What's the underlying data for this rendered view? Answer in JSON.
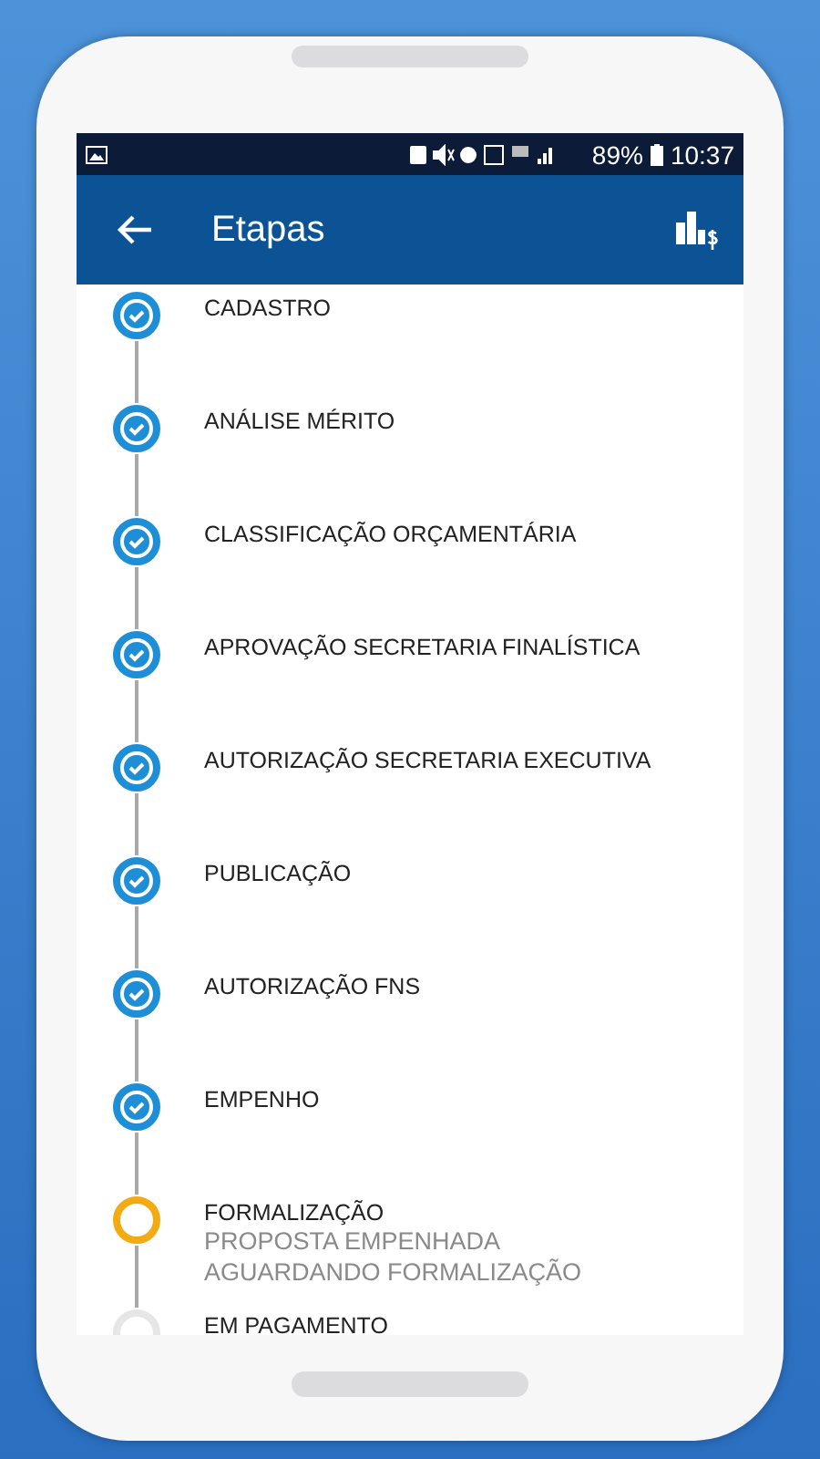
{
  "status_bar": {
    "battery": "89%",
    "time": "10:37"
  },
  "app_bar": {
    "title": "Etapas"
  },
  "steps": [
    {
      "label": "CADASTRO",
      "completed": true,
      "current": false
    },
    {
      "label": "ANÁLISE MÉRITO",
      "completed": true,
      "current": false
    },
    {
      "label": "CLASSIFICAÇÃO ORÇAMENTÁRIA",
      "completed": true,
      "current": false
    },
    {
      "label": "APROVAÇÃO SECRETARIA FINALÍSTICA",
      "completed": true,
      "current": false
    },
    {
      "label": "AUTORIZAÇÃO SECRETARIA EXECUTIVA",
      "completed": true,
      "current": false
    },
    {
      "label": "PUBLICAÇÃO",
      "completed": true,
      "current": false
    },
    {
      "label": "AUTORIZAÇÃO FNS",
      "completed": true,
      "current": false
    },
    {
      "label": "EMPENHO",
      "completed": true,
      "current": false
    },
    {
      "label": "FORMALIZAÇÃO",
      "completed": false,
      "current": true,
      "details": [
        "PROPOSTA EMPENHADA",
        "AGUARDANDO FORMALIZAÇÃO"
      ]
    },
    {
      "label": "EM PAGAMENTO",
      "completed": false,
      "current": false
    }
  ]
}
